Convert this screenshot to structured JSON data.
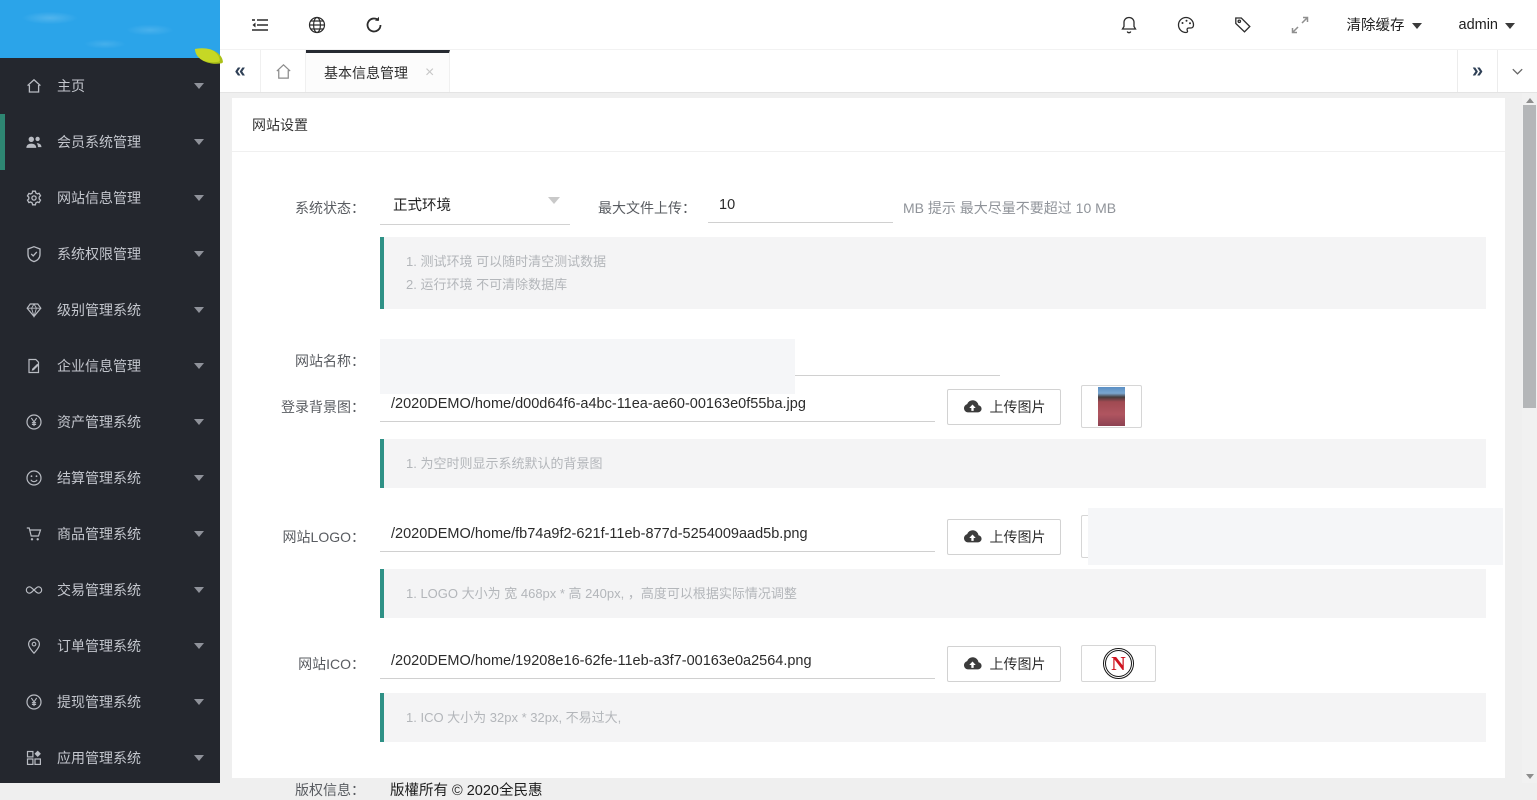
{
  "sidebar": {
    "items": [
      {
        "label": "主页",
        "icon": "home-icon",
        "active": false
      },
      {
        "label": "会员系统管理",
        "icon": "users-icon",
        "active": true
      },
      {
        "label": "网站信息管理",
        "icon": "gear-icon",
        "active": false
      },
      {
        "label": "系统权限管理",
        "icon": "shield-check-icon",
        "active": false
      },
      {
        "label": "级别管理系统",
        "icon": "diamond-icon",
        "active": false
      },
      {
        "label": "企业信息管理",
        "icon": "document-edit-icon",
        "active": false
      },
      {
        "label": "资产管理系统",
        "icon": "yen-circle-icon",
        "active": false
      },
      {
        "label": "结算管理系统",
        "icon": "smiley-icon",
        "active": false
      },
      {
        "label": "商品管理系统",
        "icon": "cart-icon",
        "active": false
      },
      {
        "label": "交易管理系统",
        "icon": "infinity-icon",
        "active": false
      },
      {
        "label": "订单管理系统",
        "icon": "location-pin-icon",
        "active": false
      },
      {
        "label": "提现管理系统",
        "icon": "yen-circle-icon",
        "active": false
      },
      {
        "label": "应用管理系统",
        "icon": "apps-icon",
        "active": false
      }
    ]
  },
  "header": {
    "clear_cache_label": "清除缓存",
    "user_label": "admin"
  },
  "tabs": {
    "active_tab": "基本信息管理"
  },
  "page": {
    "title": "网站设置"
  },
  "form": {
    "upload_button_label": "上传图片",
    "system_status": {
      "label": "系统状态：",
      "value": "正式环境"
    },
    "max_upload": {
      "label": "最大文件上传：",
      "value": "10",
      "hint": "MB 提示 最大尽量不要超过 10 MB"
    },
    "status_notes": [
      "1. 测试环境 可以随时清空测试数据",
      "2. 运行环境 不可清除数据库"
    ],
    "site_name": {
      "label": "网站名称："
    },
    "login_bg": {
      "label": "登录背景图：",
      "value": "/2020DEMO/home/d00d64f6-a4bc-11ea-ae60-00163e0f55ba.jpg",
      "note": "1. 为空时则显示系统默认的背景图"
    },
    "logo": {
      "label": "网站LOGO：",
      "value": "/2020DEMO/home/fb74a9f2-621f-11eb-877d-5254009aad5b.png",
      "note": "1. LOGO 大小为 宽 468px * 高 240px, ，高度可以根据实际情况调整"
    },
    "ico": {
      "label": "网站ICO：",
      "value": "/2020DEMO/home/19208e16-62fe-11eb-a3f7-00163e0a2564.png",
      "note": "1. ICO 大小为 32px * 32px, 不易过大,",
      "thumb_letter": "N"
    },
    "copyright": {
      "label": "版权信息：",
      "value": "版權所有 © 2020全民惠"
    }
  },
  "colors": {
    "accent_teal": "#2f9186",
    "sidebar_bg": "#24272e",
    "logo_blue": "#2ba4e9",
    "leaf_green": "#c6d825"
  }
}
